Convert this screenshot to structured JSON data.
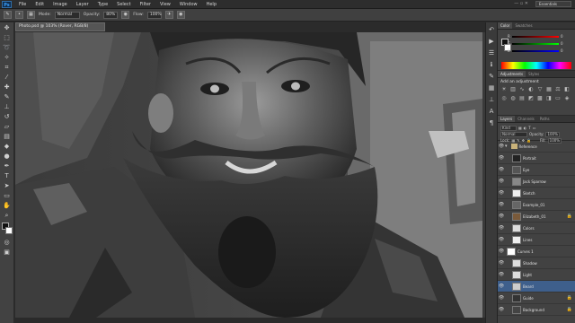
{
  "app": {
    "logo": "Ps"
  },
  "menus": [
    "File",
    "Edit",
    "Image",
    "Layer",
    "Type",
    "Select",
    "Filter",
    "View",
    "Window",
    "Help"
  ],
  "workspace": "Essentials",
  "options": {
    "mode_label": "Mode:",
    "mode_value": "Normal",
    "opacity_label": "Opacity:",
    "opacity_value": "80%",
    "flow_label": "Flow:",
    "flow_value": "100%"
  },
  "document": {
    "tab_title": "Photo.psd @ 103% (Rover, RGB/8)"
  },
  "panels": {
    "color_tabs": [
      "Color",
      "Swatches"
    ],
    "color_sliders": [
      {
        "label": "R",
        "value": "0",
        "color": "#e04040"
      },
      {
        "label": "G",
        "value": "0",
        "color": "#40c040"
      },
      {
        "label": "B",
        "value": "0",
        "color": "#4060e0"
      }
    ],
    "adjust_tabs": [
      "Adjustments",
      "Styles"
    ],
    "adjust_title": "Add an adjustment",
    "layer_tabs": [
      "Layers",
      "Channels",
      "Paths"
    ],
    "kind_value": "Kind",
    "blend_value": "Normal",
    "opacity_label": "Opacity:",
    "opacity_value": "100%",
    "lock_label": "Lock:",
    "fill_label": "Fill:",
    "fill_value": "100%",
    "layers": [
      {
        "name": "Reference",
        "type": "group",
        "visible": true
      },
      {
        "name": "Portrait",
        "type": "layer",
        "visible": true,
        "thumb": "#222"
      },
      {
        "name": "Eye",
        "type": "layer",
        "visible": true,
        "thumb": "#555"
      },
      {
        "name": "Jack Sparrow",
        "type": "layer",
        "visible": true,
        "thumb": "#888"
      },
      {
        "name": "Sketch",
        "type": "layer",
        "visible": true,
        "thumb": "#eee"
      },
      {
        "name": "Example_01",
        "type": "layer",
        "visible": true,
        "thumb": "#666"
      },
      {
        "name": "Elizabeth_01",
        "type": "layer",
        "visible": true,
        "thumb": "#7a5a3a",
        "locked": true
      },
      {
        "name": "Colors",
        "type": "layer",
        "visible": true,
        "thumb": "#ddd"
      },
      {
        "name": "Lines",
        "type": "layer",
        "visible": true,
        "thumb": "#eee"
      },
      {
        "name": "Curves 1",
        "type": "adjust",
        "visible": true,
        "thumb": "#fff"
      },
      {
        "name": "Shadow",
        "type": "layer",
        "visible": true,
        "thumb": "#ddd"
      },
      {
        "name": "Light",
        "type": "layer",
        "visible": true,
        "thumb": "#ddd"
      },
      {
        "name": "Beard",
        "type": "layer",
        "visible": true,
        "thumb": "#ccc",
        "active": true
      },
      {
        "name": "Guide",
        "type": "layer",
        "visible": true,
        "thumb": "#333",
        "locked": true
      },
      {
        "name": "Background",
        "type": "layer",
        "visible": true,
        "thumb": "#444",
        "locked": true
      }
    ]
  },
  "colors": {
    "selection": "#3e5f8c"
  }
}
